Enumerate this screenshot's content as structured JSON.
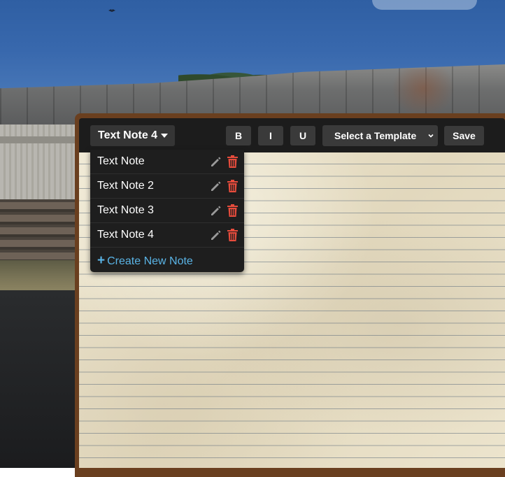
{
  "note_selector": {
    "label": "Text Note 4"
  },
  "toolbar": {
    "bold_label": "B",
    "italic_label": "I",
    "underline_label": "U",
    "template_select_label": "Select a Template",
    "save_label": "Save"
  },
  "dropdown": {
    "items": [
      {
        "label": "Text Note"
      },
      {
        "label": "Text Note 2"
      },
      {
        "label": "Text Note 3"
      },
      {
        "label": "Text Note 4"
      }
    ],
    "create_label": "Create New Note"
  },
  "colors": {
    "toolbar_bg": "#1c1c1c",
    "button_bg": "#3a3a3a",
    "trash_red": "#e74c3c",
    "link_blue": "#5ab4e6",
    "frame_brown": "#6a3f1f",
    "paper": "#ebe3cc"
  },
  "icons": {
    "edit": "pencil-icon",
    "delete": "trash-icon",
    "selector_caret": "caret-down-icon",
    "select_chevron": "chevron-down-icon",
    "create": "plus-icon"
  }
}
